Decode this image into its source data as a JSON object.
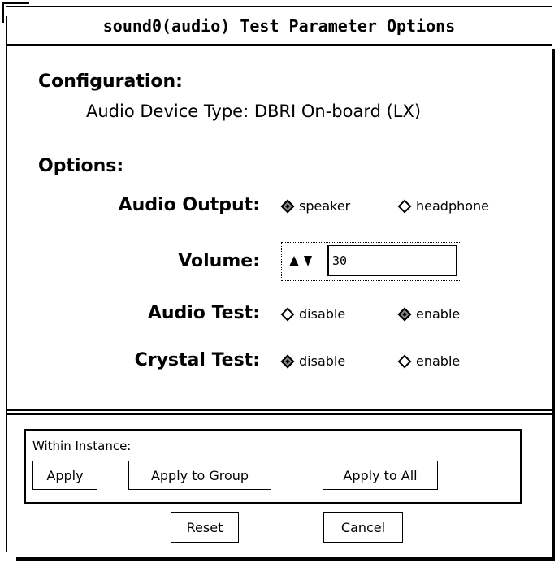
{
  "window": {
    "title": "sound0(audio) Test Parameter Options"
  },
  "configuration": {
    "heading": "Configuration:",
    "device_type": "Audio Device Type: DBRI On-board (LX)"
  },
  "options": {
    "heading": "Options:",
    "audio_output": {
      "label": "Audio Output:",
      "choices": [
        "speaker",
        "headphone"
      ],
      "selected": "speaker"
    },
    "volume": {
      "label": "Volume:",
      "value": "30"
    },
    "audio_test": {
      "label": "Audio Test:",
      "choices": [
        "disable",
        "enable"
      ],
      "selected": "enable"
    },
    "crystal_test": {
      "label": "Crystal Test:",
      "choices": [
        "disable",
        "enable"
      ],
      "selected": "disable"
    }
  },
  "instance": {
    "label": "Within Instance:",
    "apply": "Apply",
    "apply_group": "Apply to Group",
    "apply_all": "Apply to All"
  },
  "footer": {
    "reset": "Reset",
    "cancel": "Cancel"
  }
}
